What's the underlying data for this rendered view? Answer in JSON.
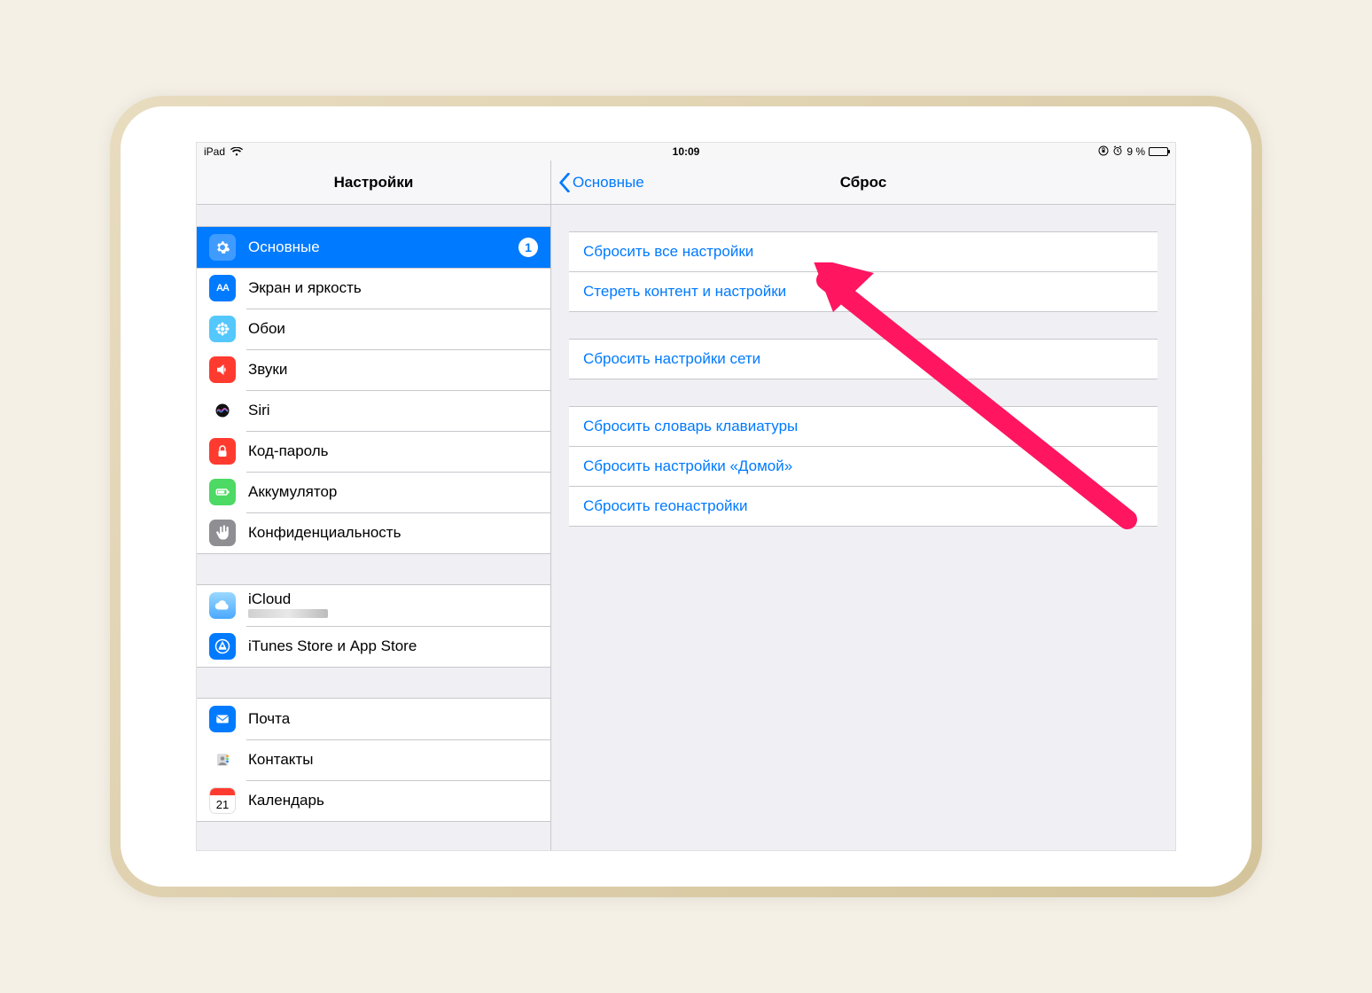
{
  "status": {
    "device": "iPad",
    "time": "10:09",
    "battery_text": "9 %"
  },
  "sidebar": {
    "title": "Настройки",
    "groups": [
      {
        "items": [
          {
            "id": "general",
            "label": "Основные",
            "badge": "1",
            "selected": true
          },
          {
            "id": "display",
            "label": "Экран и яркость"
          },
          {
            "id": "wallpaper",
            "label": "Обои"
          },
          {
            "id": "sounds",
            "label": "Звуки"
          },
          {
            "id": "siri",
            "label": "Siri"
          },
          {
            "id": "passcode",
            "label": "Код-пароль"
          },
          {
            "id": "battery",
            "label": "Аккумулятор"
          },
          {
            "id": "privacy",
            "label": "Конфиденциальность"
          }
        ]
      },
      {
        "items": [
          {
            "id": "icloud",
            "label": "iCloud",
            "has_sub": true
          },
          {
            "id": "store",
            "label": "iTunes Store и App Store"
          }
        ]
      },
      {
        "items": [
          {
            "id": "mail",
            "label": "Почта"
          },
          {
            "id": "contacts",
            "label": "Контакты"
          },
          {
            "id": "calendar",
            "label": "Календарь"
          }
        ]
      }
    ]
  },
  "detail": {
    "back_label": "Основные",
    "title": "Сброс",
    "groups": [
      {
        "items": [
          {
            "id": "reset-all-settings",
            "label": "Сбросить все настройки"
          },
          {
            "id": "erase-content",
            "label": "Стереть контент и настройки"
          }
        ]
      },
      {
        "items": [
          {
            "id": "reset-network",
            "label": "Сбросить настройки сети"
          }
        ]
      },
      {
        "items": [
          {
            "id": "reset-keyboard",
            "label": "Сбросить словарь клавиатуры"
          },
          {
            "id": "reset-home",
            "label": "Сбросить настройки «Домой»"
          },
          {
            "id": "reset-location",
            "label": "Сбросить геонастройки"
          }
        ]
      }
    ]
  },
  "icons": {
    "general": "gear",
    "display": "text-size",
    "wallpaper": "flower",
    "sounds": "speaker",
    "siri": "siri",
    "passcode": "lock",
    "battery": "battery",
    "privacy": "hand",
    "icloud": "cloud",
    "store": "appstore",
    "mail": "mail",
    "contacts": "contacts",
    "calendar": "calendar"
  }
}
